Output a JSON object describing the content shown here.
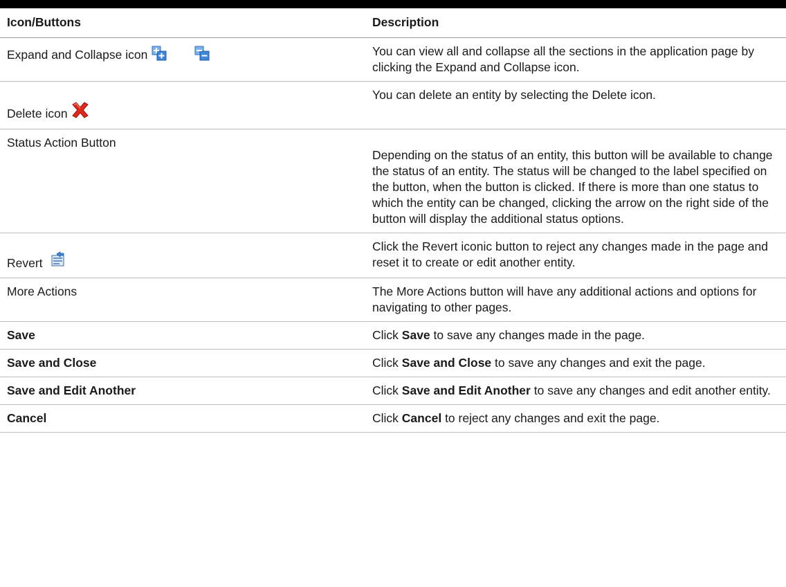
{
  "header": {
    "col1": "Icon/Buttons",
    "col2": "Description"
  },
  "rows": [
    {
      "label": "Expand and Collapse icon",
      "icons": [
        "expand-icon",
        "collapse-icon"
      ],
      "description": "You can view all and collapse all the sections in the application page by clicking the Expand and Collapse icon."
    },
    {
      "label": "Delete icon",
      "icons": [
        "delete-icon"
      ],
      "description": "You can delete an entity by selecting the Delete icon."
    },
    {
      "label": "Status Action Button",
      "description": "Depending on the status of an entity, this button will be available to change the status of an entity. The status will be changed to the label specified on the button, when the button is clicked. If there is more than one status to which the entity can be changed, clicking the arrow on the right side of the button will display the additional status options."
    },
    {
      "label": "Revert",
      "icons": [
        "revert-icon"
      ],
      "description": "Click the Revert iconic button to reject any changes made in the page and reset it to create or edit another entity."
    },
    {
      "label": "More Actions",
      "description": "The More Actions button will have any additional actions and options for navigating to other pages."
    },
    {
      "label": "Save",
      "description_pre": "Click",
      "description_bold": "Save",
      "description_post": "to save any changes made in the page."
    },
    {
      "label": "Save and Close",
      "description_pre": "Click",
      "description_bold": "Save and Close",
      "description_post": "to save any changes and exit the page."
    },
    {
      "label": "Save and Edit Another",
      "description_pre": "Click",
      "description_bold": "Save and Edit Another",
      "description_post": "to save any changes and edit another entity."
    },
    {
      "label": "Cancel",
      "description_pre": "Click",
      "description_bold": "Cancel",
      "description_post": "to reject any changes and exit the page."
    }
  ],
  "colors": {
    "rule": "#000000",
    "expand_blue": "#3f86d8",
    "delete_red": "#e0281c"
  }
}
